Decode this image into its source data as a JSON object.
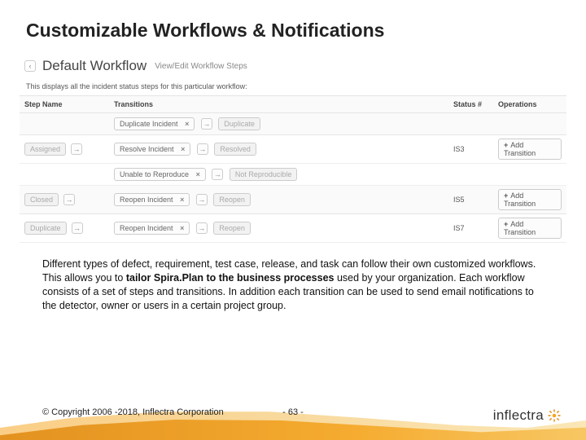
{
  "title": "Customizable Workflows & Notifications",
  "app": {
    "workflow_title": "Default Workflow",
    "workflow_subtitle": "View/Edit Workflow Steps",
    "description": "This displays all the incident status steps for this particular workflow:",
    "columns": {
      "step": "Step Name",
      "transitions": "Transitions",
      "status": "Status #",
      "operations": "Operations"
    },
    "add_transition_label": "Add Transition",
    "rows": [
      {
        "type": "group",
        "transition": "Duplicate Incident",
        "target": "Duplicate"
      },
      {
        "type": "step",
        "name": "Assigned",
        "transition": "Resolve Incident",
        "target": "Resolved",
        "status": "IS3"
      },
      {
        "type": "sub",
        "transition": "Unable to Reproduce",
        "target": "Not Reproducible"
      },
      {
        "type": "step",
        "name": "Closed",
        "transition": "Reopen Incident",
        "target": "Reopen",
        "status": "IS5"
      },
      {
        "type": "step",
        "name": "Duplicate",
        "transition": "Reopen Incident",
        "target": "Reopen",
        "status": "IS7"
      }
    ]
  },
  "body": {
    "p1a": "Different types of defect, requirement, test case, release, and task can follow their own customized workflows. This allows you to ",
    "p1b": "tailor Spira.Plan to the business processes",
    "p1c": " used by your organization. Each workflow consists of a set of steps and transitions. In addition each transition can be used to send email notifications to the detector, owner or users in a certain project group."
  },
  "footer": {
    "copyright": "© Copyright 2006 -2018, Inflectra Corporation",
    "page": "- 63 -",
    "logo": "inflectra"
  }
}
